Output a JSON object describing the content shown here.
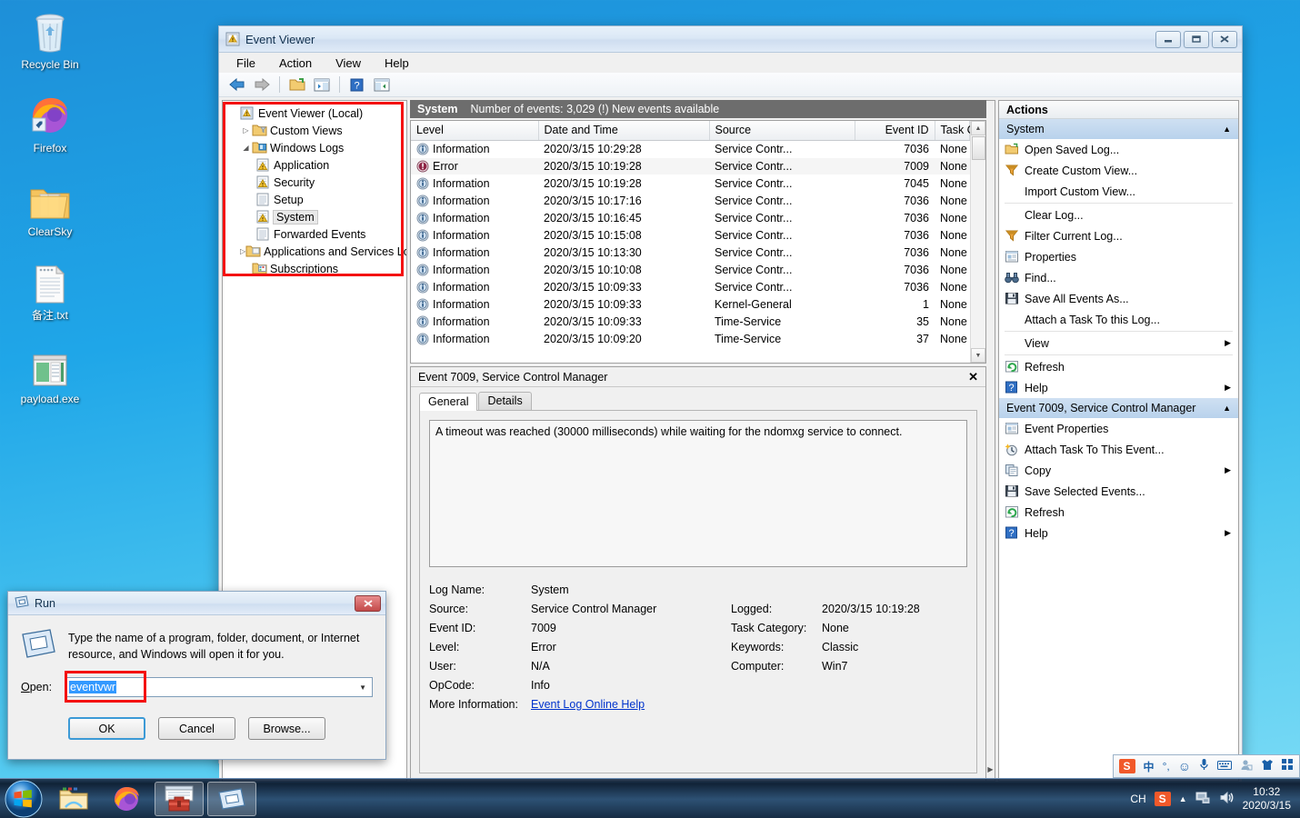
{
  "desktop": {
    "icons": [
      {
        "name": "recycle-bin",
        "label": "Recycle Bin"
      },
      {
        "name": "firefox",
        "label": "Firefox"
      },
      {
        "name": "clearsky-folder",
        "label": "ClearSky"
      },
      {
        "name": "notes-txt",
        "label": "备注.txt"
      },
      {
        "name": "payload-exe",
        "label": "payload.exe"
      }
    ]
  },
  "event_viewer": {
    "title": "Event Viewer",
    "window_buttons": {
      "minimize": "—",
      "maximize": "❐",
      "close": "✕"
    },
    "menu": [
      "File",
      "Action",
      "View",
      "Help"
    ],
    "toolbar_icons": [
      "back-arrow-icon",
      "forward-arrow-icon",
      "open-folder-icon",
      "show-tree-icon",
      "help-icon",
      "show-action-pane-icon"
    ],
    "tree": [
      {
        "label": "Event Viewer (Local)",
        "level": 0,
        "expander": "",
        "icon": "event-viewer-icon",
        "selected": false
      },
      {
        "label": "Custom Views",
        "level": 1,
        "expander": "▷",
        "icon": "custom-views-icon",
        "selected": false
      },
      {
        "label": "Windows Logs",
        "level": 1,
        "expander": "◢",
        "icon": "windows-logs-icon",
        "selected": false
      },
      {
        "label": "Application",
        "level": 2,
        "expander": "",
        "icon": "log-icon",
        "selected": false
      },
      {
        "label": "Security",
        "level": 2,
        "expander": "",
        "icon": "log-icon",
        "selected": false
      },
      {
        "label": "Setup",
        "level": 2,
        "expander": "",
        "icon": "plain-log-icon",
        "selected": false
      },
      {
        "label": "System",
        "level": 2,
        "expander": "",
        "icon": "log-icon",
        "selected": true
      },
      {
        "label": "Forwarded Events",
        "level": 2,
        "expander": "",
        "icon": "plain-log-icon",
        "selected": false
      },
      {
        "label": "Applications and Services Lo",
        "level": 1,
        "expander": "▷",
        "icon": "app-services-icon",
        "selected": false
      },
      {
        "label": "Subscriptions",
        "level": 1,
        "expander": "",
        "icon": "subscriptions-icon",
        "selected": false
      }
    ],
    "log_header": {
      "log_name": "System",
      "status": "Number of events: 3,029 (!) New events available"
    },
    "list": {
      "columns": [
        "Level",
        "Date and Time",
        "Source",
        "Event ID",
        "Task Category"
      ],
      "rows": [
        {
          "level": "Information",
          "icon": "information-icon",
          "datetime": "2020/3/15 10:29:28",
          "source": "Service Contr...",
          "event_id": "7036",
          "task_category": "None"
        },
        {
          "level": "Error",
          "icon": "error-icon",
          "datetime": "2020/3/15 10:19:28",
          "source": "Service Contr...",
          "event_id": "7009",
          "task_category": "None"
        },
        {
          "level": "Information",
          "icon": "information-icon",
          "datetime": "2020/3/15 10:19:28",
          "source": "Service Contr...",
          "event_id": "7045",
          "task_category": "None"
        },
        {
          "level": "Information",
          "icon": "information-icon",
          "datetime": "2020/3/15 10:17:16",
          "source": "Service Contr...",
          "event_id": "7036",
          "task_category": "None"
        },
        {
          "level": "Information",
          "icon": "information-icon",
          "datetime": "2020/3/15 10:16:45",
          "source": "Service Contr...",
          "event_id": "7036",
          "task_category": "None"
        },
        {
          "level": "Information",
          "icon": "information-icon",
          "datetime": "2020/3/15 10:15:08",
          "source": "Service Contr...",
          "event_id": "7036",
          "task_category": "None"
        },
        {
          "level": "Information",
          "icon": "information-icon",
          "datetime": "2020/3/15 10:13:30",
          "source": "Service Contr...",
          "event_id": "7036",
          "task_category": "None"
        },
        {
          "level": "Information",
          "icon": "information-icon",
          "datetime": "2020/3/15 10:10:08",
          "source": "Service Contr...",
          "event_id": "7036",
          "task_category": "None"
        },
        {
          "level": "Information",
          "icon": "information-icon",
          "datetime": "2020/3/15 10:09:33",
          "source": "Service Contr...",
          "event_id": "7036",
          "task_category": "None"
        },
        {
          "level": "Information",
          "icon": "information-icon",
          "datetime": "2020/3/15 10:09:33",
          "source": "Kernel-General",
          "event_id": "1",
          "task_category": "None"
        },
        {
          "level": "Information",
          "icon": "information-icon",
          "datetime": "2020/3/15 10:09:33",
          "source": "Time-Service",
          "event_id": "35",
          "task_category": "None"
        },
        {
          "level": "Information",
          "icon": "information-icon",
          "datetime": "2020/3/15 10:09:20",
          "source": "Time-Service",
          "event_id": "37",
          "task_category": "None"
        }
      ]
    },
    "detail": {
      "header": "Event 7009, Service Control Manager",
      "close": "✕",
      "tabs": [
        {
          "label": "General",
          "active": true
        },
        {
          "label": "Details",
          "active": false
        }
      ],
      "message": "A timeout was reached (30000 milliseconds) while waiting for the ndomxg service to connect.",
      "fields": [
        {
          "k1": "Log Name:",
          "v1": "System",
          "k2": "",
          "v2": ""
        },
        {
          "k1": "Source:",
          "v1": "Service Control Manager",
          "k2": "Logged:",
          "v2": "2020/3/15 10:19:28"
        },
        {
          "k1": "Event ID:",
          "v1": "7009",
          "k2": "Task Category:",
          "v2": "None"
        },
        {
          "k1": "Level:",
          "v1": "Error",
          "k2": "Keywords:",
          "v2": "Classic"
        },
        {
          "k1": "User:",
          "v1": "N/A",
          "k2": "Computer:",
          "v2": "Win7"
        },
        {
          "k1": "OpCode:",
          "v1": "Info",
          "k2": "",
          "v2": ""
        }
      ],
      "more_info_label": "More Information:",
      "more_info_link": "Event Log Online Help"
    },
    "actions": {
      "title": "Actions",
      "groups": [
        {
          "label": "System",
          "collapse": "▲",
          "items": [
            {
              "label": "Open Saved Log...",
              "icon": "open-folder-icon",
              "submenu": false,
              "sep_after": false
            },
            {
              "label": "Create Custom View...",
              "icon": "filter-icon",
              "submenu": false,
              "sep_after": false
            },
            {
              "label": "Import Custom View...",
              "icon": "",
              "submenu": false,
              "sep_after": true
            },
            {
              "label": "Clear Log...",
              "icon": "",
              "submenu": false,
              "sep_after": false
            },
            {
              "label": "Filter Current Log...",
              "icon": "filter-icon",
              "submenu": false,
              "sep_after": false
            },
            {
              "label": "Properties",
              "icon": "properties-icon",
              "submenu": false,
              "sep_after": false
            },
            {
              "label": "Find...",
              "icon": "binoculars-icon",
              "submenu": false,
              "sep_after": false
            },
            {
              "label": "Save All Events As...",
              "icon": "save-icon",
              "submenu": false,
              "sep_after": false
            },
            {
              "label": "Attach a Task To this Log...",
              "icon": "",
              "submenu": false,
              "sep_after": true
            },
            {
              "label": "View",
              "icon": "",
              "submenu": true,
              "sep_after": true
            },
            {
              "label": "Refresh",
              "icon": "refresh-icon",
              "submenu": false,
              "sep_after": false
            },
            {
              "label": "Help",
              "icon": "help-icon",
              "submenu": true,
              "sep_after": false
            }
          ]
        },
        {
          "label": "Event 7009, Service Control Manager",
          "collapse": "▲",
          "items": [
            {
              "label": "Event Properties",
              "icon": "properties-icon",
              "submenu": false,
              "sep_after": false
            },
            {
              "label": "Attach Task To This Event...",
              "icon": "clock-task-icon",
              "submenu": false,
              "sep_after": false
            },
            {
              "label": "Copy",
              "icon": "copy-icon",
              "submenu": true,
              "sep_after": false
            },
            {
              "label": "Save Selected Events...",
              "icon": "save-icon",
              "submenu": false,
              "sep_after": false
            },
            {
              "label": "Refresh",
              "icon": "refresh-icon",
              "submenu": false,
              "sep_after": false
            },
            {
              "label": "Help",
              "icon": "help-icon",
              "submenu": true,
              "sep_after": false
            }
          ]
        }
      ]
    }
  },
  "run_dialog": {
    "title": "Run",
    "close": "✕",
    "description": "Type the name of a program, folder, document, or Internet resource, and Windows will open it for you.",
    "open_label": "Open:",
    "open_value": "eventvwr",
    "buttons": [
      {
        "label": "OK",
        "default": true
      },
      {
        "label": "Cancel",
        "default": false
      },
      {
        "label": "Browse...",
        "default": false
      }
    ]
  },
  "taskbar": {
    "start": "start-orb-icon",
    "items": [
      {
        "name": "explorer-taskbar-icon",
        "active": false
      },
      {
        "name": "firefox-taskbar-icon",
        "active": false
      },
      {
        "name": "toolbox-taskbar-icon",
        "active": true
      },
      {
        "name": "run-taskbar-icon",
        "active": true
      }
    ],
    "tray": {
      "language": "CH",
      "ime": "S",
      "show_hidden": "▲",
      "network_icon": "network-icon",
      "volume_icon": "volume-icon",
      "time": "10:32",
      "date": "2020/3/15"
    },
    "ime_bar": {
      "logo": "S",
      "mode": "中",
      "punct": "°,",
      "emoji": "☺",
      "mic": "mic-icon",
      "keyboard": "keyboard-icon",
      "user": "user-icon",
      "skin": "skin-icon",
      "apps": "apps-icon"
    }
  }
}
